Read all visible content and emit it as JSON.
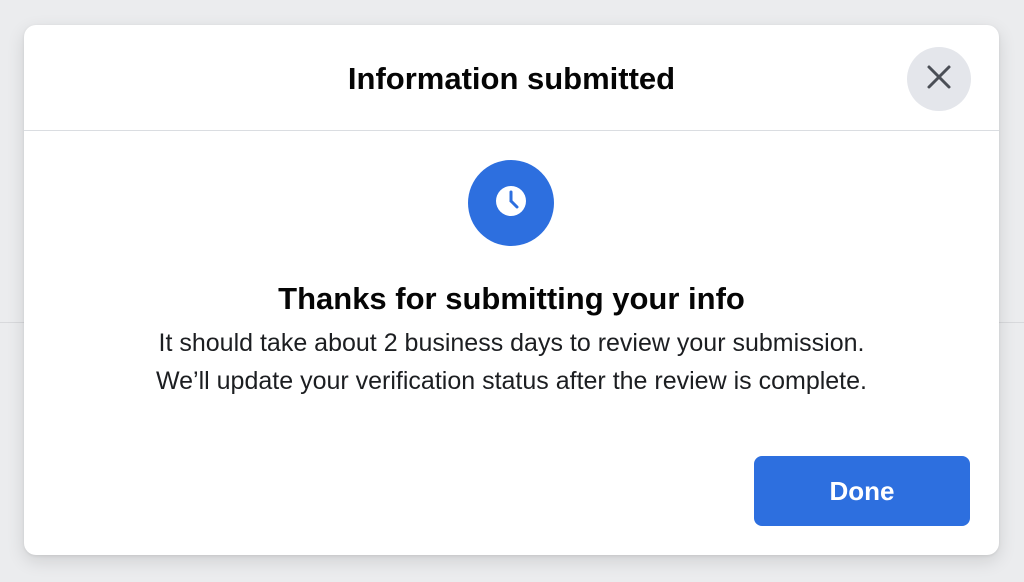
{
  "modal": {
    "title": "Information submitted",
    "heading": "Thanks for submitting your info",
    "message_line1": "It should take about 2 business days to review your submission.",
    "message_line2": "We’ll update your verification status after the review is complete.",
    "done_label": "Done",
    "close_icon": "close-icon",
    "status_icon": "clock-icon"
  },
  "colors": {
    "accent": "#2D6FDF",
    "close_bg": "#E4E6EB",
    "title_text": "#050505"
  }
}
